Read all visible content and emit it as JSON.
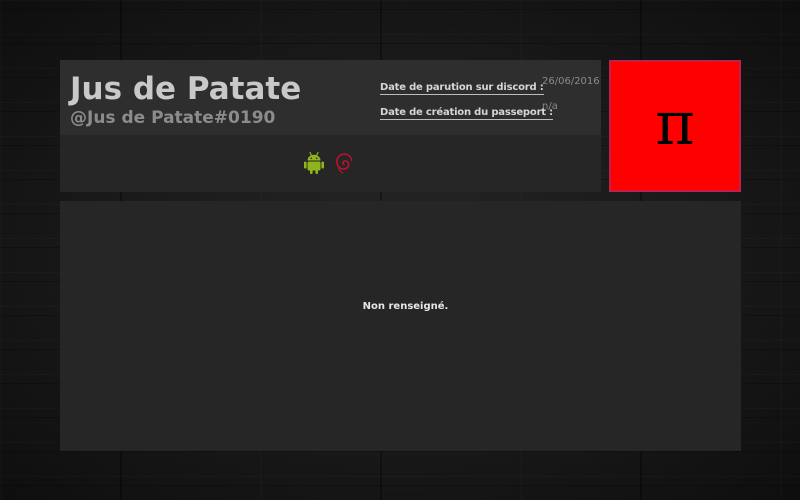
{
  "profile": {
    "username": "Jus de Patate",
    "handle": "@Jus de Patate#0190",
    "info": [
      {
        "label": "Date de parution sur discord :",
        "value": "26/06/2016"
      },
      {
        "label": "Date de création du passeport :",
        "value": "n/a"
      }
    ],
    "os_icons": [
      "android-icon",
      "debian-icon"
    ]
  },
  "avatar": {
    "glyph": "π",
    "background": "#ff0000",
    "border": "#c0204a"
  },
  "description": {
    "text": "Non renseigné."
  },
  "colors": {
    "android": "#8fb51e",
    "debian": "#c8102e"
  }
}
